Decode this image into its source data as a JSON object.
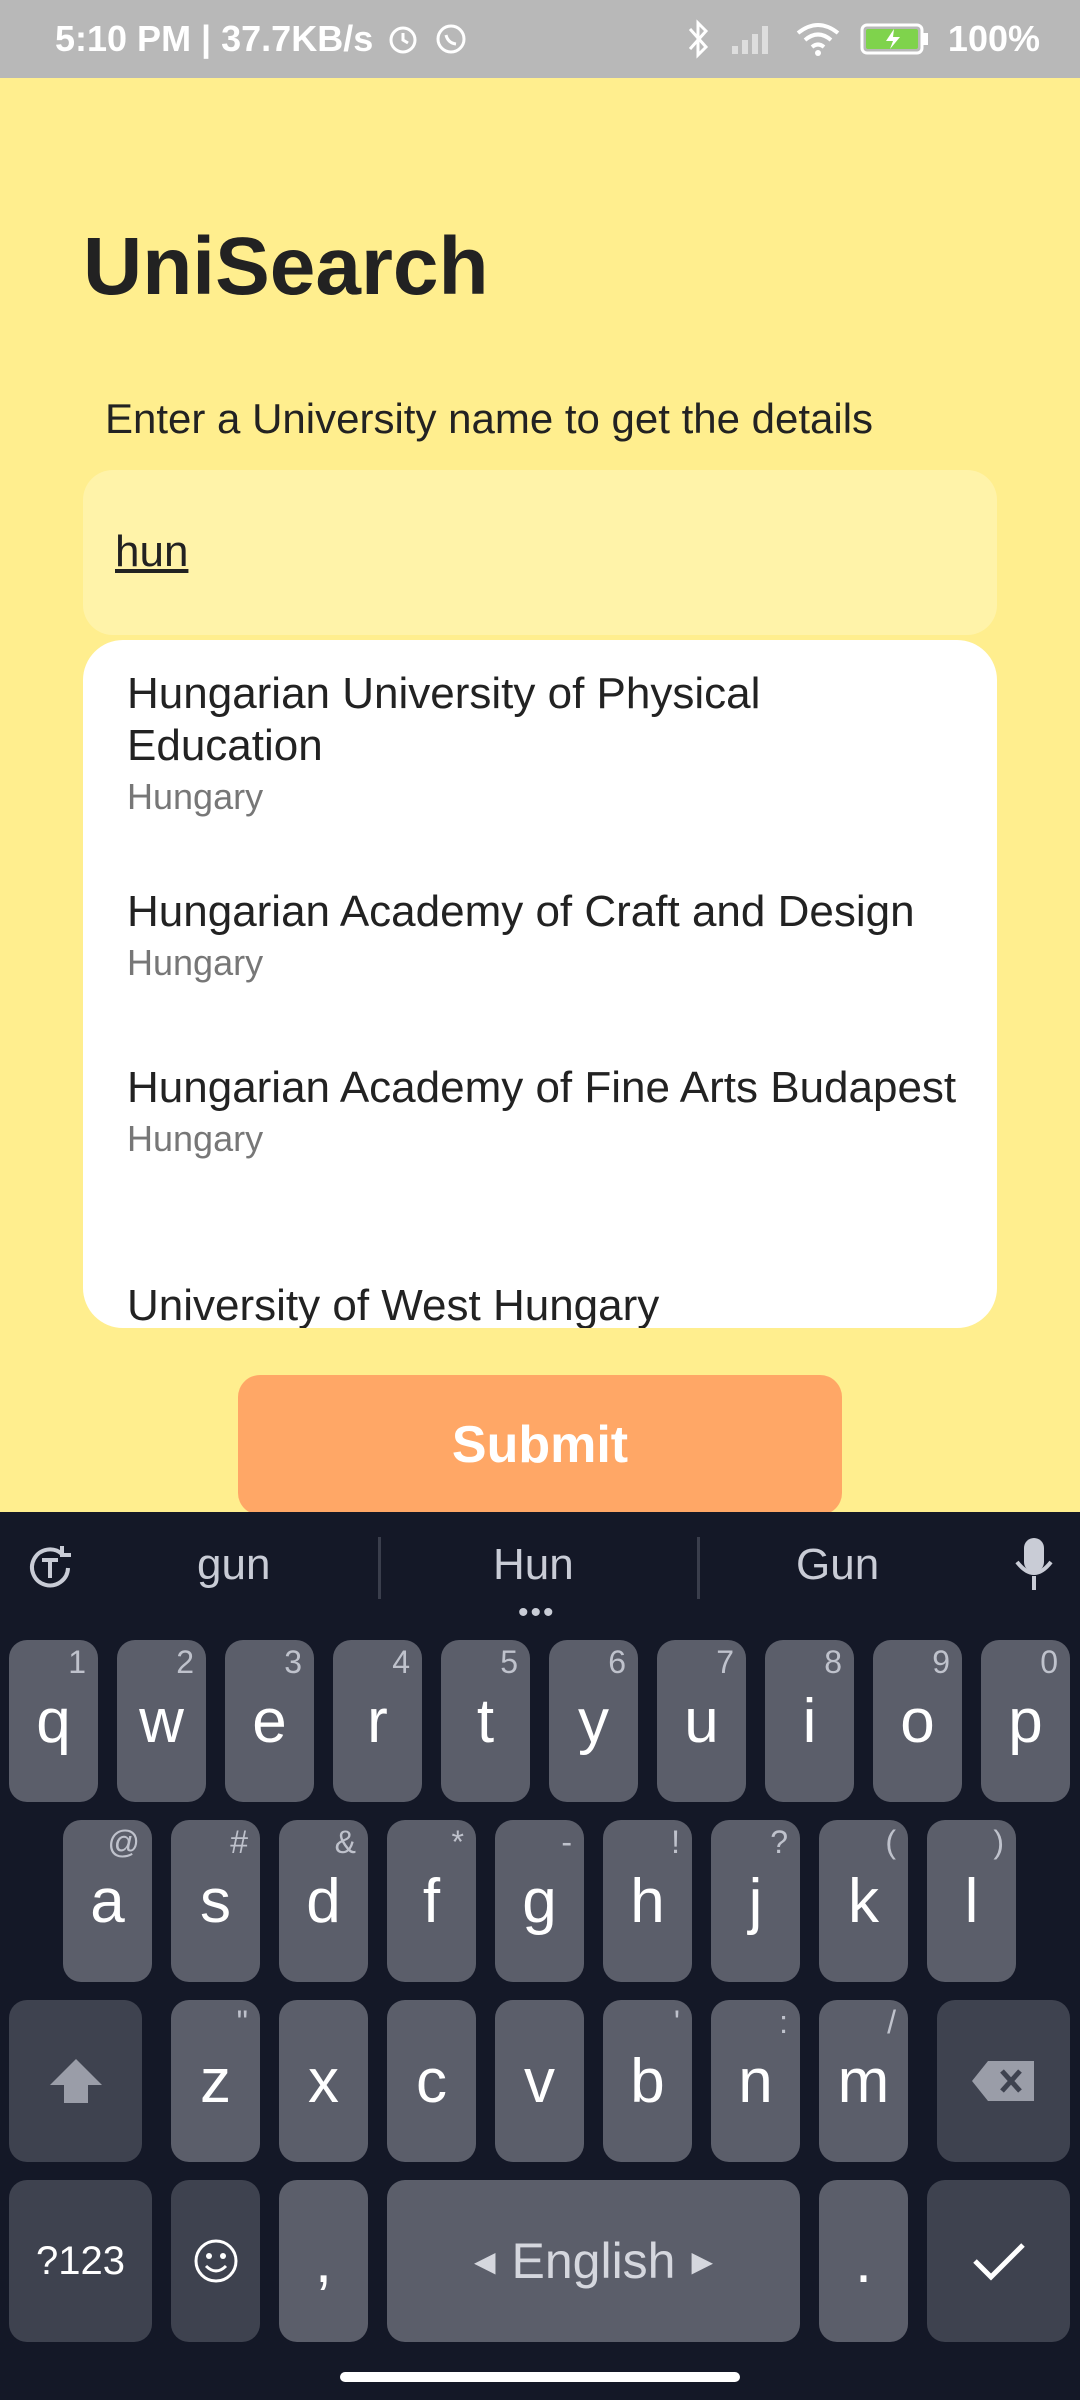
{
  "status_bar": {
    "time_speed": "5:10 PM | 37.7KB/s",
    "battery": "100%"
  },
  "app": {
    "title": "UniSearch",
    "subtitle": "Enter a University name to get the details"
  },
  "search": {
    "value": "hun"
  },
  "results": [
    {
      "name": "Hungarian University of Physical Education",
      "country": "Hungary"
    },
    {
      "name": "Hungarian Academy of Craft and Design",
      "country": "Hungary"
    },
    {
      "name": "Hungarian Academy of Fine Arts Budapest",
      "country": "Hungary"
    },
    {
      "name": "University of West Hungary",
      "country": ""
    }
  ],
  "submit_label": "Submit",
  "keyboard": {
    "suggestions": [
      "gun",
      "Hun",
      "Gun"
    ],
    "row1": [
      {
        "key": "q",
        "hint": "1"
      },
      {
        "key": "w",
        "hint": "2"
      },
      {
        "key": "e",
        "hint": "3"
      },
      {
        "key": "r",
        "hint": "4"
      },
      {
        "key": "t",
        "hint": "5"
      },
      {
        "key": "y",
        "hint": "6"
      },
      {
        "key": "u",
        "hint": "7"
      },
      {
        "key": "i",
        "hint": "8"
      },
      {
        "key": "o",
        "hint": "9"
      },
      {
        "key": "p",
        "hint": "0"
      }
    ],
    "row2": [
      {
        "key": "a",
        "hint": "@"
      },
      {
        "key": "s",
        "hint": "#"
      },
      {
        "key": "d",
        "hint": "&"
      },
      {
        "key": "f",
        "hint": "*"
      },
      {
        "key": "g",
        "hint": "-"
      },
      {
        "key": "h",
        "hint": "!"
      },
      {
        "key": "j",
        "hint": "?"
      },
      {
        "key": "k",
        "hint": "("
      },
      {
        "key": "l",
        "hint": ")"
      }
    ],
    "row3": [
      {
        "key": "z",
        "hint": "\""
      },
      {
        "key": "x",
        "hint": ""
      },
      {
        "key": "c",
        "hint": ""
      },
      {
        "key": "v",
        "hint": ""
      },
      {
        "key": "b",
        "hint": "'"
      },
      {
        "key": "n",
        "hint": ":"
      },
      {
        "key": "m",
        "hint": "/"
      }
    ],
    "symbols_label": "?123",
    "comma": ",",
    "space_label": "English",
    "period": "."
  }
}
